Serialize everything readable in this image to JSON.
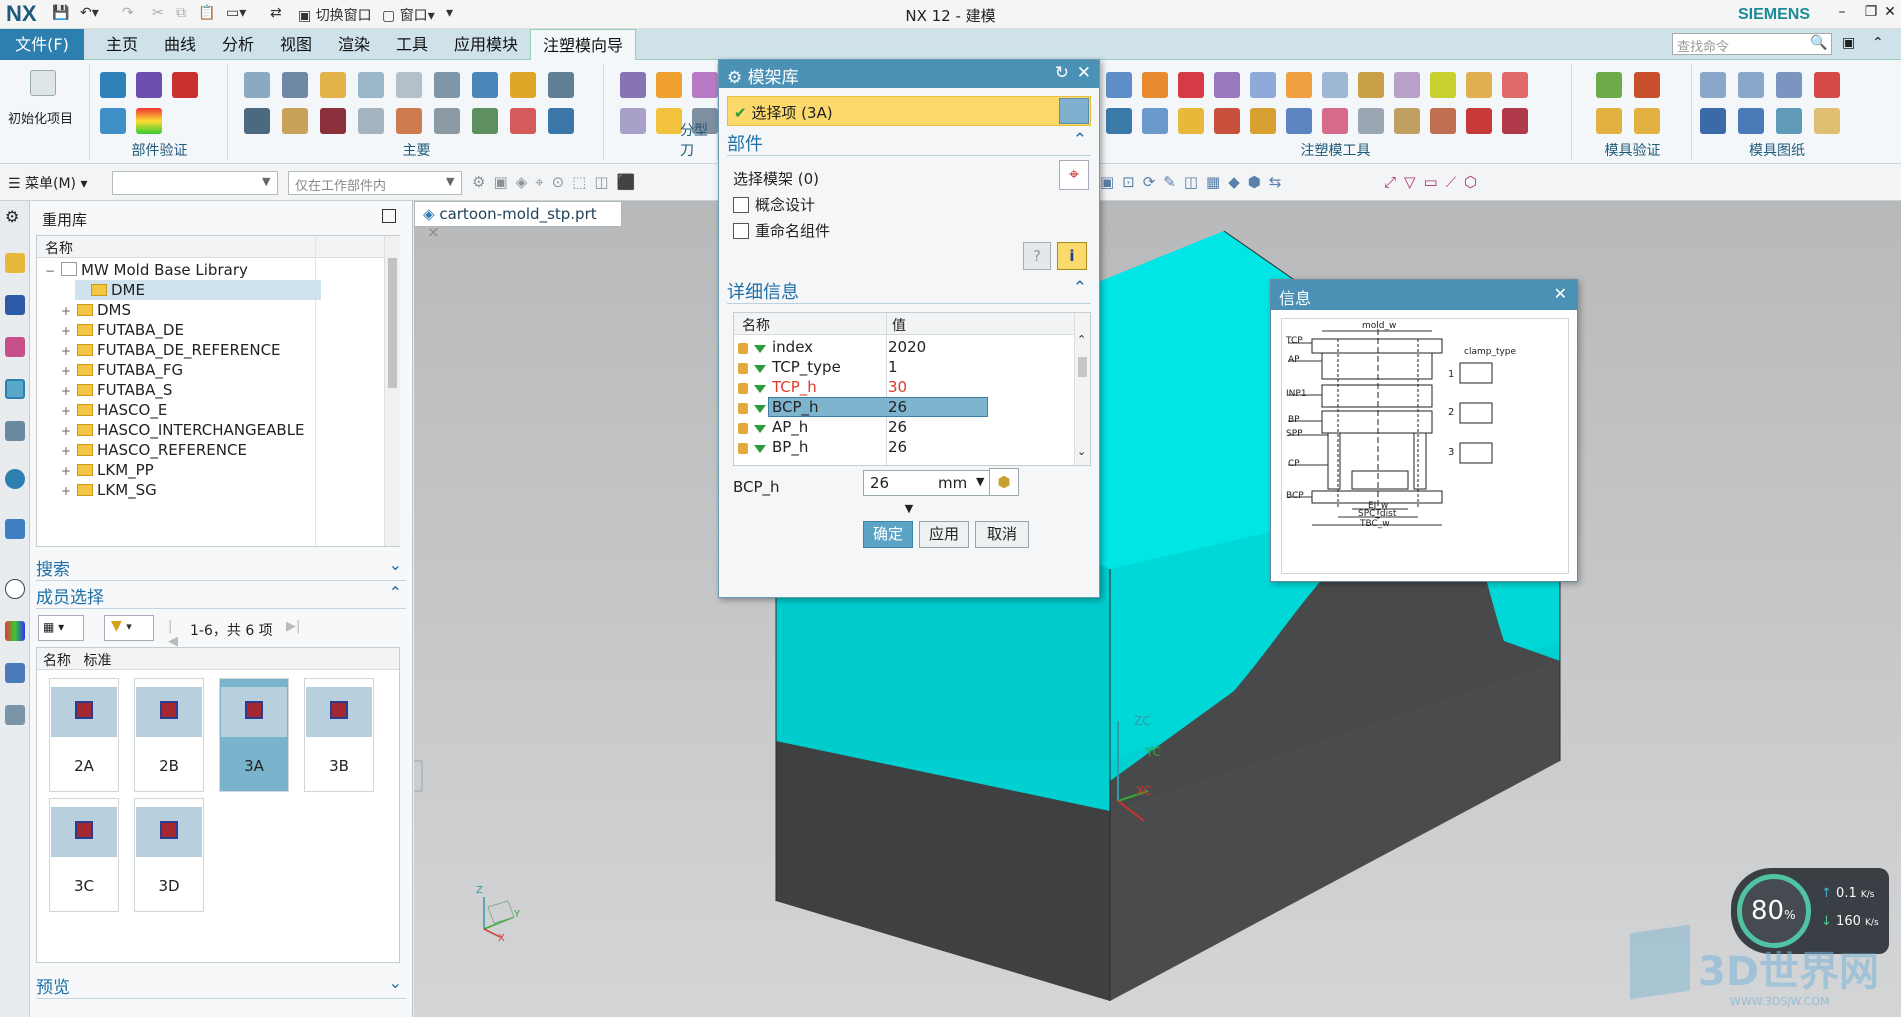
{
  "app": {
    "logo": "NX",
    "window_title": "NX 12 - 建模",
    "brand": "SIEMENS",
    "quick_access": {
      "switch_window": "切换窗口",
      "window": "窗口"
    }
  },
  "menu_tabs": [
    "文件(F)",
    "主页",
    "曲线",
    "分析",
    "视图",
    "渲染",
    "工具",
    "应用模块",
    "注塑模向导"
  ],
  "command_search": {
    "placeholder": "查找命令"
  },
  "ribbon": {
    "init_project": "初始化项目",
    "groups": [
      "部件验证",
      "主要",
      "分型刀",
      "注塑模工具",
      "模具验证",
      "模具图纸"
    ]
  },
  "toolbar2": {
    "menu_label": "菜单(M)",
    "filter_combo": "",
    "scope_combo": "仅在工作部件内"
  },
  "reuse_panel": {
    "title": "重用库",
    "column_name": "名称",
    "tree": [
      {
        "label": "MW Mold Base Library",
        "level": 0,
        "expander": "−"
      },
      {
        "label": "DME",
        "level": 1,
        "expander": ""
      },
      {
        "label": "DMS",
        "level": 1,
        "expander": "+"
      },
      {
        "label": "FUTABA_DE",
        "level": 1,
        "expander": "+"
      },
      {
        "label": "FUTABA_DE_REFERENCE",
        "level": 1,
        "expander": "+"
      },
      {
        "label": "FUTABA_FG",
        "level": 1,
        "expander": "+"
      },
      {
        "label": "FUTABA_S",
        "level": 1,
        "expander": "+"
      },
      {
        "label": "HASCO_E",
        "level": 1,
        "expander": "+"
      },
      {
        "label": "HASCO_INTERCHANGEABLE",
        "level": 1,
        "expander": "+"
      },
      {
        "label": "HASCO_REFERENCE",
        "level": 1,
        "expander": "+"
      },
      {
        "label": "LKM_PP",
        "level": 1,
        "expander": "+"
      },
      {
        "label": "LKM_SG",
        "level": 1,
        "expander": "+"
      }
    ],
    "search_section": "搜索",
    "member_section": "成员选择",
    "paging": "1-6，共 6 项",
    "member_columns": [
      "名称",
      "标准"
    ],
    "members": [
      "2A",
      "2B",
      "3A",
      "3B",
      "3C",
      "3D"
    ],
    "preview_section": "预览"
  },
  "doc_tab": {
    "label": "cartoon-mold_stp.prt",
    "close": "×"
  },
  "dialog": {
    "title": "模架库",
    "selection": "选择项 (3A)",
    "section_part": "部件",
    "select_mold_base": "选择模架 (0)",
    "concept_design": "概念设计",
    "rename_component": "重命名组件",
    "section_details": "详细信息",
    "col_name": "名称",
    "col_value": "值",
    "params": [
      {
        "name": "index",
        "value": "2020"
      },
      {
        "name": "TCP_type",
        "value": "1"
      },
      {
        "name": "TCP_h",
        "value": "30"
      },
      {
        "name": "BCP_h",
        "value": "26"
      },
      {
        "name": "AP_h",
        "value": "26"
      },
      {
        "name": "BP_h",
        "value": "26"
      }
    ],
    "edit_label": "BCP_h",
    "edit_value": "26",
    "edit_unit": "mm",
    "ok": "确定",
    "apply": "应用",
    "cancel": "取消"
  },
  "info_window": {
    "title": "信息",
    "diagram_labels": {
      "left": [
        "TCP",
        "AP",
        "INP1",
        "BP",
        "SPP",
        "CP",
        "BCP"
      ],
      "top": "mold_w",
      "bottom": [
        "EJ_w",
        "SPC_dist",
        "TBC_w"
      ],
      "clamp_title": "clamp_type",
      "clamp_types": [
        "1",
        "2",
        "3"
      ]
    }
  },
  "axes": {
    "zc": "ZC",
    "yc": "YC",
    "xc": "XC",
    "z": "Z",
    "y": "Y",
    "x": "X"
  },
  "speed_widget": {
    "percent": "80",
    "unit": "%",
    "up": "0.1",
    "down": "160",
    "rate_unit": "K/s"
  },
  "watermark": {
    "text": "3D世界网",
    "url": "WWW.3DSJW.COM"
  },
  "colors": {
    "accent": "#4a91b5",
    "model_top": "#00d8d8",
    "model_base": "#4a4b4d"
  }
}
